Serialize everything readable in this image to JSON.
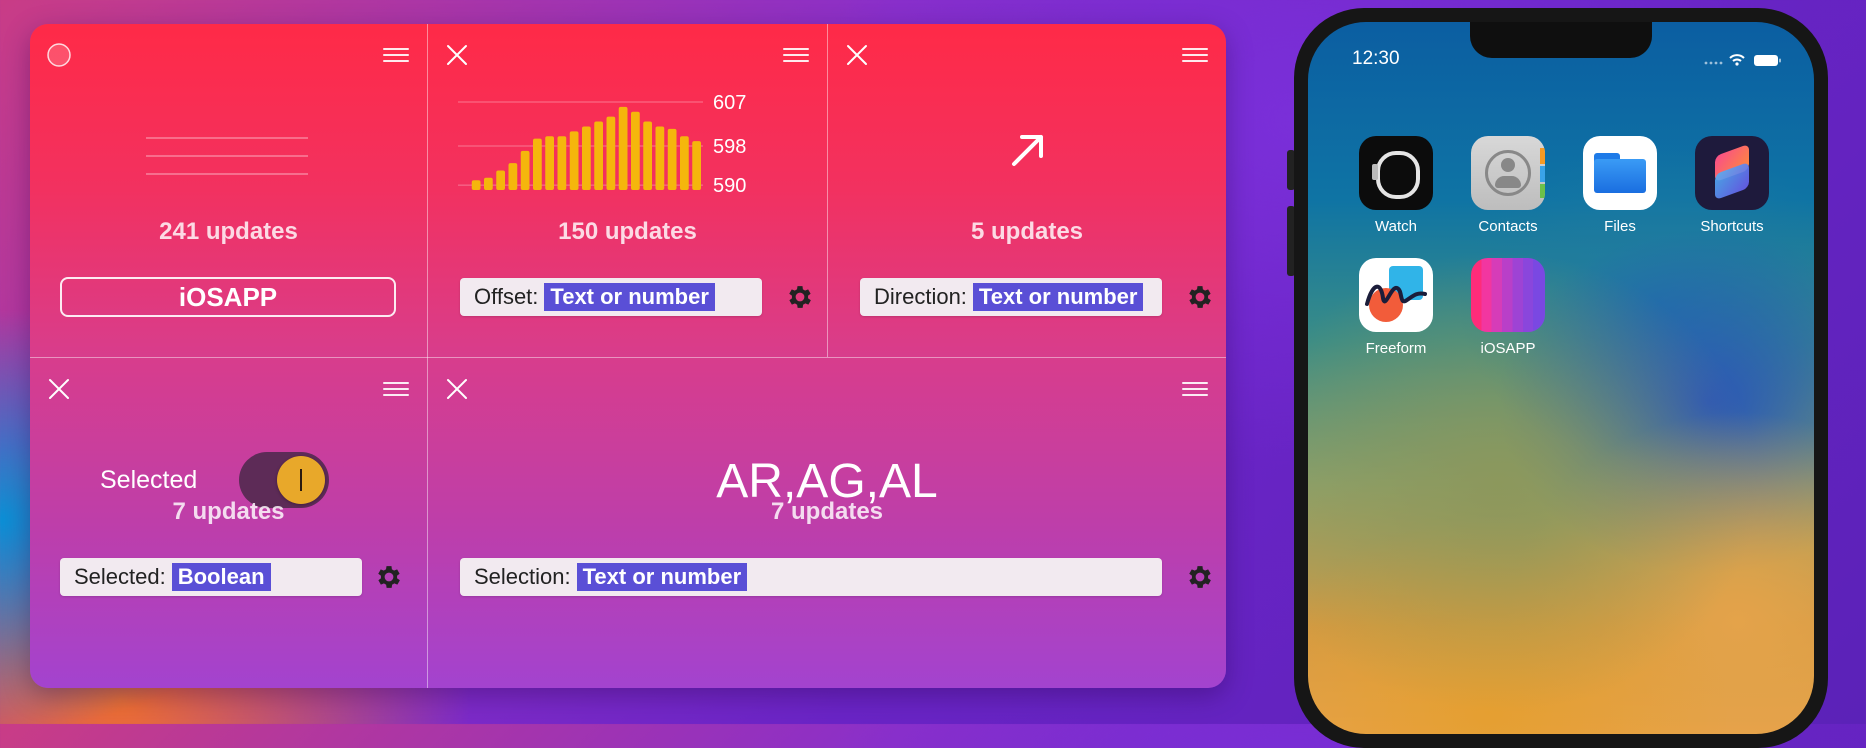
{
  "widgets": {
    "w1": {
      "updates": "241 updates",
      "button_label": "iOSAPP"
    },
    "w2": {
      "updates": "150 updates",
      "chart_data": {
        "type": "bar",
        "values": [
          589,
          591,
          591.5,
          593,
          594.5,
          597,
          599.5,
          600,
          600,
          601,
          602,
          603,
          604,
          606,
          605,
          603,
          602,
          601.5,
          600,
          599
        ],
        "tick_labels": [
          "607",
          "598",
          "590"
        ],
        "ylim": [
          589,
          607
        ],
        "color": "#f5b60c"
      },
      "field_label": "Offset:",
      "field_token": "Text or number"
    },
    "w3": {
      "updates": "5 updates",
      "field_label": "Direction:",
      "field_token": "Text or number"
    },
    "w4": {
      "toggle_label": "Selected",
      "toggle_on": true,
      "updates": "7 updates",
      "field_label": "Selected:",
      "field_token": "Boolean"
    },
    "w5": {
      "value": "AR,AG,AL",
      "updates": "7 updates",
      "field_label": "Selection:",
      "field_token": "Text or number"
    }
  },
  "phone": {
    "time": "12:30",
    "apps": [
      {
        "label": "Watch",
        "icon": "watch-icon"
      },
      {
        "label": "Contacts",
        "icon": "contacts-icon"
      },
      {
        "label": "Files",
        "icon": "files-icon"
      },
      {
        "label": "Shortcuts",
        "icon": "shortcuts-icon"
      },
      {
        "label": "Freeform",
        "icon": "freeform-icon"
      },
      {
        "label": "iOSAPP",
        "icon": "iosapp-icon"
      }
    ]
  },
  "colors": {
    "panel_top": "#ff2a47",
    "panel_bottom": "#a343cf",
    "token": "#5a4fd6",
    "toggle_knob": "#e8a82a",
    "bars": "#f5b60c"
  }
}
